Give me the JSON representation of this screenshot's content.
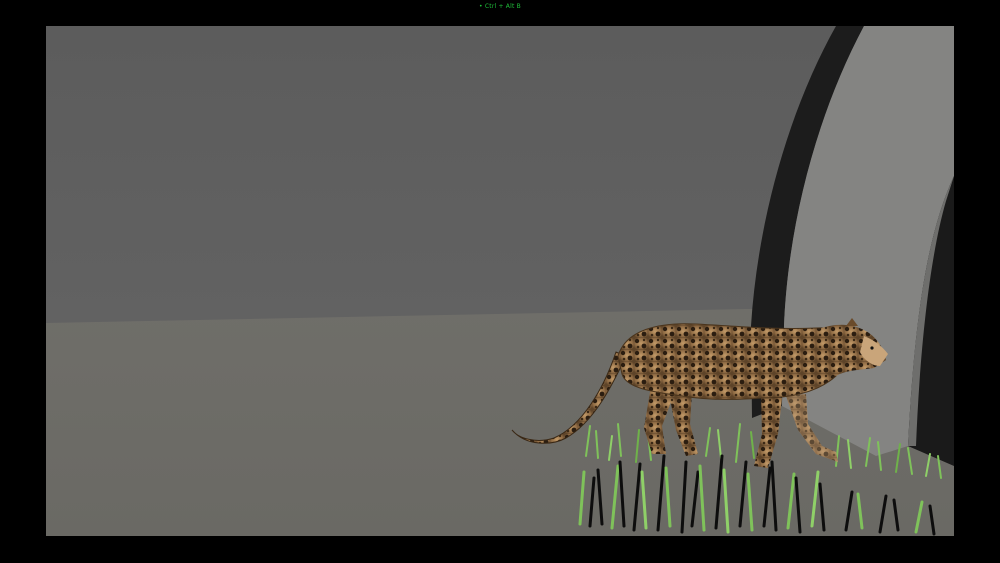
{
  "viewport": {
    "caption": "• Ctrl + Alt B",
    "scene": "3d-render-leopard-walking-on-grass",
    "colors": {
      "background": "#000000",
      "wall": "#5e5e5e",
      "floor": "#6c6b66",
      "arch_dark": "#1e1e1e",
      "arch_light": "#8a8a88",
      "grass_green": "#7fc25a",
      "grass_dark": "#0d0d0d",
      "caption": "#1fbf3a"
    }
  }
}
